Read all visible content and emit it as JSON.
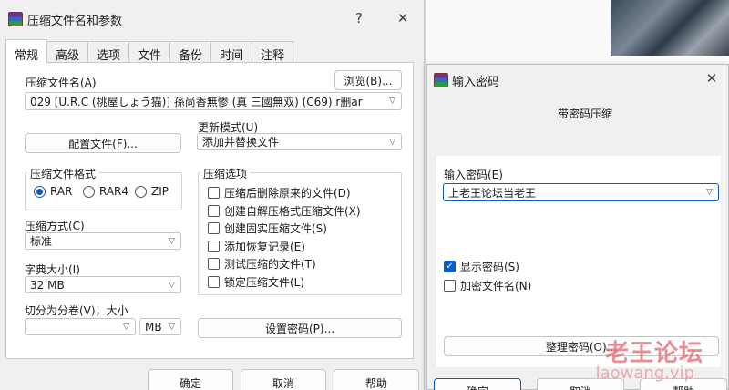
{
  "main": {
    "title": "压缩文件名和参数",
    "help_btn": "?",
    "close_btn": "✕",
    "tabs": [
      "常规",
      "高级",
      "选项",
      "文件",
      "备份",
      "时间",
      "注释"
    ],
    "archive_name_label": "压缩文件名(A)",
    "browse_label": "浏览(B)...",
    "archive_name_value": "029   [U.R.C (桃屋しょう猫)] 孫尚香無惨 (真 三國無双) (C69).r删ar",
    "update_mode_label": "更新模式(U)",
    "update_mode_value": "添加并替换文件",
    "profiles_label": "配置文件(F)...",
    "format_group": "压缩文件格式",
    "formats": [
      "RAR",
      "RAR4",
      "ZIP"
    ],
    "method_label": "压缩方式(C)",
    "method_value": "标准",
    "dict_label": "字典大小(I)",
    "dict_value": "32 MB",
    "split_label": "切分为分卷(V)，大小",
    "split_value": "",
    "split_unit": "MB",
    "options_group": "压缩选项",
    "options": [
      {
        "label": "压缩后删除原来的文件(D)",
        "checked": false
      },
      {
        "label": "创建自解压格式压缩文件(X)",
        "checked": false
      },
      {
        "label": "创建固实压缩文件(S)",
        "checked": false
      },
      {
        "label": "添加恢复记录(E)",
        "checked": false
      },
      {
        "label": "测试压缩的文件(T)",
        "checked": false
      },
      {
        "label": "锁定压缩文件(L)",
        "checked": false
      }
    ],
    "set_password_label": "设置密码(P)...",
    "ok_label": "确定",
    "cancel_label": "取消",
    "help_label": "帮助"
  },
  "password_dialog": {
    "title": "输入密码",
    "close_btn": "✕",
    "subtitle": "带密码压缩",
    "enter_label": "输入密码(E)",
    "password_value": "上老王论坛当老王",
    "show_password_label": "显示密码(S)",
    "show_password_checked": true,
    "encrypt_names_label": "加密文件名(N)",
    "encrypt_names_checked": false,
    "organize_label": "整理密码(O)...",
    "ok_label": "确定",
    "cancel_label": "取消",
    "help_label": "帮助"
  },
  "watermark": {
    "text": "老王论坛",
    "url": "laowang.vip"
  },
  "colors": {
    "accent": "#0b5cc7",
    "dialog_bg": "#f0f0f0"
  }
}
